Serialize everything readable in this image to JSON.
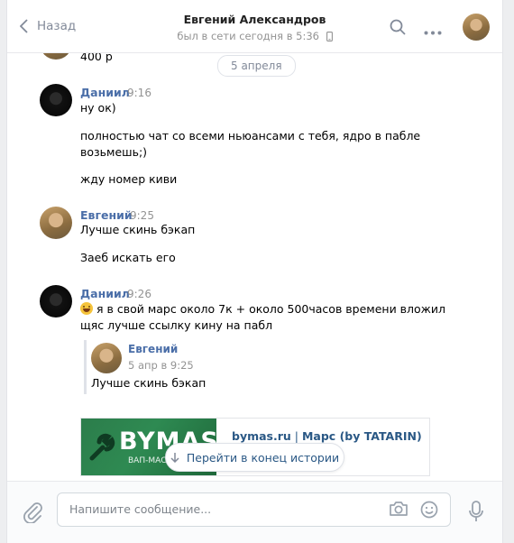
{
  "header": {
    "back_label": "Назад",
    "title": "Евгений Александров",
    "status": "был в сети сегодня в 5:36"
  },
  "messages": {
    "top_partial": "400 р",
    "date_separator": "5 апреля",
    "g1": {
      "name": "Даниил",
      "time": "9:16",
      "lines": [
        "ну ок)",
        "полностью чат со всеми ньюансами с тебя, ядро в пабле",
        "возьмешь;)",
        "жду номер киви"
      ]
    },
    "g2": {
      "name": "Евгений",
      "time": "9:25",
      "lines": [
        "Лучше скинь бэкап",
        "Заеб искать его"
      ]
    },
    "g3": {
      "name": "Даниил",
      "time": "9:26",
      "lines": [
        "я в свой марс около 7к + около 500часов времени вложил",
        "щяс лучше ссылку кину на пабл"
      ],
      "quote": {
        "name": "Евгений",
        "date": "5 апр в 9:25",
        "text": "Лучше скинь бэкап"
      },
      "link": {
        "domain": "bymas.ru",
        "separator": " | ",
        "title": "Марс (by TATARIN)",
        "image_logo": "BYMAS.RU",
        "image_sub": "ВАП-МАС"
      }
    }
  },
  "scroll_button": "Перейти в конец истории",
  "composer": {
    "placeholder": "Напишите сообщение..."
  },
  "colors": {
    "link": "#2a5885",
    "name": "#4a6ea8",
    "muted": "#939393",
    "bg": "#edeef0"
  },
  "icons": [
    "back-chevron-icon",
    "phone-icon",
    "search-icon",
    "more-icon",
    "arrow-down-icon",
    "attach-icon",
    "camera-icon",
    "smile-icon",
    "mic-icon",
    "laughing-emoji-icon",
    "wrench-icon"
  ]
}
